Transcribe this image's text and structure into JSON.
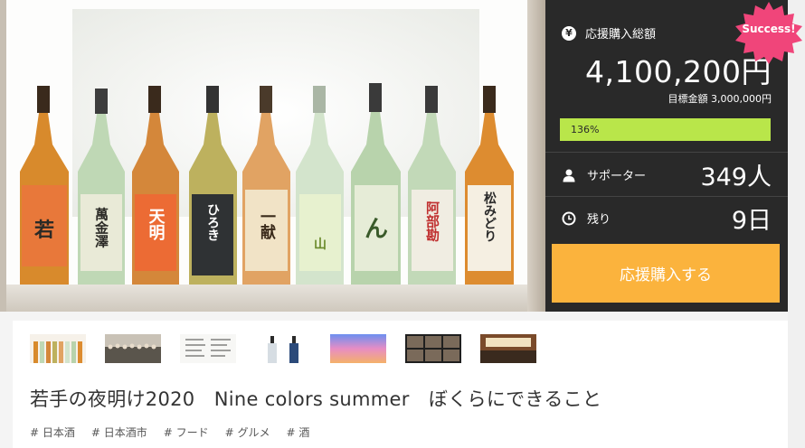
{
  "panel": {
    "total_label": "応援購入総額",
    "yen_icon": "¥",
    "total_amount": "4,100,200円",
    "target_text": "目標金額 3,000,000円",
    "progress_text": "136%",
    "progress_fraction": 1.0,
    "supporters_label": "サポーター",
    "supporters_value": "349人",
    "remaining_label": "残り",
    "remaining_value": "9日",
    "buy_button": "応援購入する",
    "badge": "Success!"
  },
  "hero": {
    "icons": [
      "sake-bottle-photo"
    ],
    "bottle_labels": [
      "若",
      "萬金澤",
      "天明",
      "ひろき",
      "一献",
      "山",
      "ん",
      "阿部勘",
      "松みどり"
    ]
  },
  "project": {
    "title": "若手の夜明け2020　Nine colors summer　ぼくらにできること",
    "tags": [
      "# 日本酒",
      "# 日本酒市",
      "# フード",
      "# グルメ",
      "# 酒"
    ]
  },
  "colors": {
    "panel_bg": "#292929",
    "progress": "#b9e64a",
    "buy_button": "#fbb33d",
    "badge": "#f0457a"
  }
}
